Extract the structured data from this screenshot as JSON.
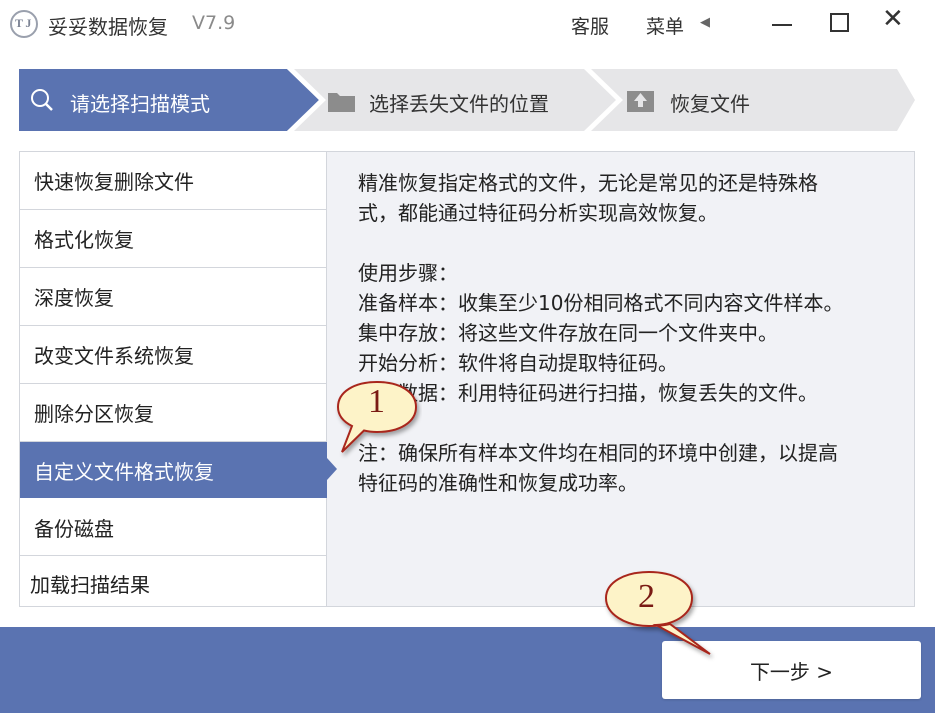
{
  "window": {
    "title": "妥妥数据恢复",
    "version": "V7.9",
    "service_label": "客服",
    "menu_label": "菜单",
    "menu_arrow": "◀",
    "logo_text": "T J"
  },
  "steps": [
    {
      "label": "请选择扫描模式",
      "icon": "search-icon",
      "active": true
    },
    {
      "label": "选择丢失文件的位置",
      "icon": "folder-icon",
      "active": false
    },
    {
      "label": "恢复文件",
      "icon": "upload-icon",
      "active": false
    }
  ],
  "modes": [
    {
      "label": "快速恢复删除文件"
    },
    {
      "label": "格式化恢复"
    },
    {
      "label": "深度恢复"
    },
    {
      "label": "改变文件系统恢复"
    },
    {
      "label": "删除分区恢复"
    },
    {
      "label": "自定义文件格式恢复",
      "selected": true
    },
    {
      "label": "备份磁盘"
    },
    {
      "label": "加载扫描结果"
    }
  ],
  "description": {
    "intro_line1": "精准恢复指定格式的文件，无论是常见的还是特殊格",
    "intro_line2": "式，都能通过特征码分析实现高效恢复。",
    "steps_title": "使用步骤：",
    "step1": "准备样本：收集至少10份相同格式不同内容文件样本。",
    "step2": "集中存放：将这些文件存放在同一个文件夹中。",
    "step3": "开始分析：软件将自动提取特征码。",
    "step4": "恢复数据：利用特征码进行扫描，恢复丢失的文件。",
    "note_line1": "注：确保所有样本文件均在相同的环境中创建，以提高",
    "note_line2": "特征码的准确性和恢复成功率。"
  },
  "next_button": {
    "label": "下一步 >"
  },
  "callouts": [
    {
      "number": "1"
    },
    {
      "number": "2"
    }
  ],
  "colors": {
    "accent": "#5a73b1",
    "step_inactive": "#e6e6e8",
    "panel_bg": "#f1f2f6",
    "callout_fill": "#fdf3c8",
    "callout_stroke": "#a8261c"
  }
}
